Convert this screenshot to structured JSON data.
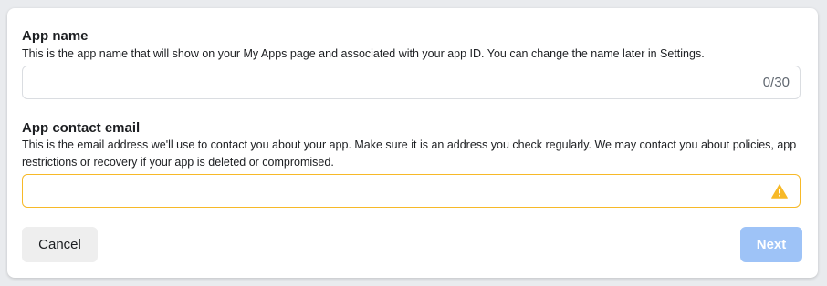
{
  "app_name": {
    "title": "App name",
    "description": "This is the app name that will show on your My Apps page and associated with your app ID. You can change the name later in Settings.",
    "value": "",
    "counter": "0/30"
  },
  "app_contact_email": {
    "title": "App contact email",
    "description": "This is the email address we'll use to contact you about your app. Make sure it is an address you check regularly. We may contact you about policies, app restrictions or recovery if your app is deleted or compromised.",
    "value": "",
    "status_icon": "warning-icon"
  },
  "actions": {
    "cancel_label": "Cancel",
    "next_label": "Next"
  },
  "colors": {
    "warning": "#f7b928",
    "next_disabled": "#9ec3f7",
    "cancel_bg": "#eeeeee"
  }
}
